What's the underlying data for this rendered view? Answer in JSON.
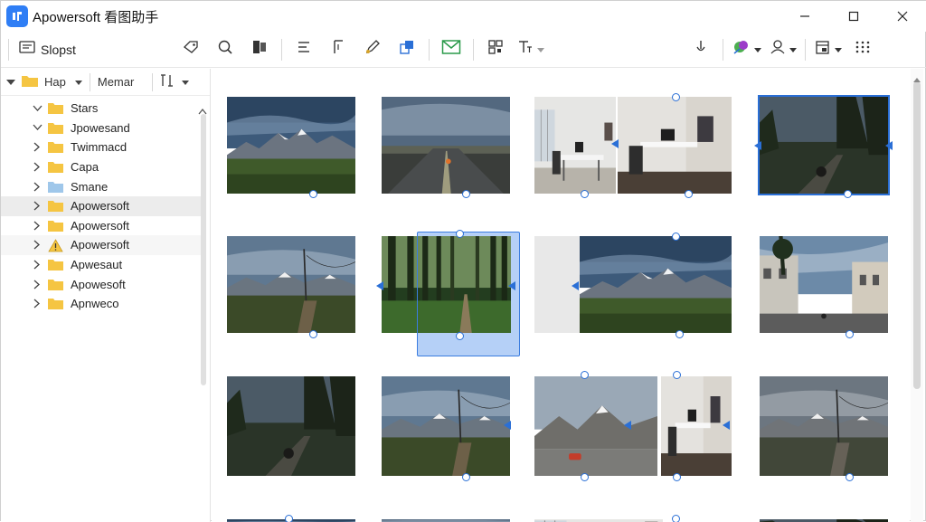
{
  "app": {
    "title": "Apowersoft 看图助手"
  },
  "toolbar": {
    "slideshow_label": "Slopst",
    "icons": [
      "slideshow-icon",
      "tag-icon",
      "search-image-icon",
      "layers-icon",
      "list-icon",
      "text-format-icon",
      "pen-icon",
      "image-stack-icon",
      "mail-icon",
      "qr-icon",
      "text-size-icon",
      "microphone-icon",
      "color-palette-icon",
      "user-icon",
      "export-icon",
      "grid-dots-icon"
    ]
  },
  "left_header": {
    "folder_label": "Hap",
    "menu_label": "Memar",
    "sort_icon": "sort-icon"
  },
  "tree": [
    {
      "label": "Stars",
      "expanded": true,
      "depth": 1
    },
    {
      "label": "Jpowesand",
      "expanded": true,
      "depth": 1
    },
    {
      "label": "Twimmacd",
      "expanded": false,
      "depth": 1
    },
    {
      "label": "Capa",
      "expanded": false,
      "depth": 1
    },
    {
      "label": "Smane",
      "expanded": false,
      "depth": 1
    },
    {
      "label": "Apowersoft",
      "expanded": false,
      "depth": 1,
      "selected": true
    },
    {
      "label": "Apowersoft",
      "expanded": false,
      "depth": 1
    },
    {
      "label": "Apowersoft",
      "expanded": false,
      "depth": 1,
      "warning": true
    },
    {
      "label": "Apwesaut",
      "expanded": false,
      "depth": 1
    },
    {
      "label": "Apowesoft",
      "expanded": false,
      "depth": 1
    },
    {
      "label": "Apnweco",
      "expanded": false,
      "depth": 1
    }
  ],
  "thumbnails": [
    {
      "name": "mountain-valley-1"
    },
    {
      "name": "road-sunset"
    },
    {
      "name": "office-interior-pair"
    },
    {
      "name": "dark-forest-road"
    },
    {
      "name": "mountain-powerline"
    },
    {
      "name": "forest-path-selected"
    },
    {
      "name": "mountain-valley-2"
    },
    {
      "name": "street-buildings"
    },
    {
      "name": "forest-dark"
    },
    {
      "name": "mountain-valley-3"
    },
    {
      "name": "mountain-car-office"
    },
    {
      "name": "mountain-field-bw"
    }
  ],
  "colors": {
    "accent": "#2a6fd6",
    "folder": "#f5c542",
    "selection": "#7aaaf0"
  }
}
